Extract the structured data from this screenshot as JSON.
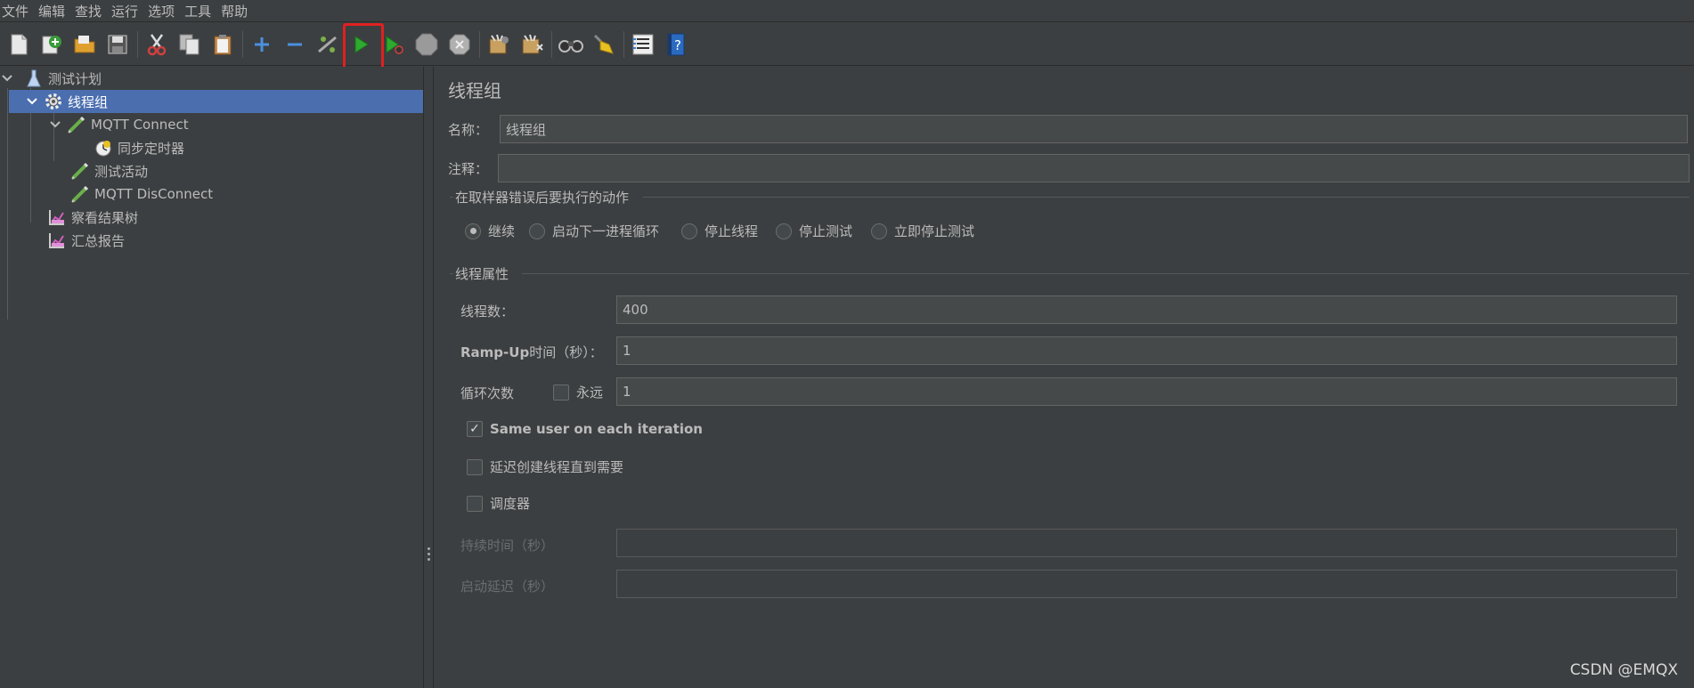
{
  "menu": [
    "文件",
    "编辑",
    "查找",
    "运行",
    "选项",
    "工具",
    "帮助"
  ],
  "toolbar": {
    "buttons": [
      {
        "name": "new-icon",
        "color": "#e8e8e8"
      },
      {
        "name": "templates-icon",
        "color": "#4caf50"
      },
      {
        "name": "open-icon",
        "color": "#e0a030"
      },
      {
        "name": "save-icon",
        "color": "#cccccc"
      },
      {
        "name": "cut-icon",
        "color": "#d04040"
      },
      {
        "name": "copy-icon",
        "color": "#cccccc"
      },
      {
        "name": "paste-icon",
        "color": "#d0a060"
      },
      {
        "name": "expand-icon",
        "color": "#4a90e0"
      },
      {
        "name": "collapse-icon",
        "color": "#4a90e0"
      },
      {
        "name": "toggle-icon",
        "color": "#aaaaaa"
      },
      {
        "name": "start-icon",
        "color": "#2eaa2e"
      },
      {
        "name": "start-no-pause-icon",
        "color": "#2eaa2e"
      },
      {
        "name": "stop-icon",
        "color": "#9a9a9a"
      },
      {
        "name": "shutdown-icon",
        "color": "#b0b0b0"
      },
      {
        "name": "remote-start-icon",
        "color": "#c8a060"
      },
      {
        "name": "remote-stop-icon",
        "color": "#c8a060"
      },
      {
        "name": "search-icon",
        "color": "#444444"
      },
      {
        "name": "clear-icon",
        "color": "#e8c020"
      },
      {
        "name": "function-helper-icon",
        "color": "#dddddd"
      },
      {
        "name": "help-icon",
        "color": "#3a80d0"
      }
    ],
    "highlight": "start-icon"
  },
  "tree": {
    "items": [
      {
        "label": "测试计划",
        "level": 0,
        "expanded": true,
        "icon": "test-plan-icon"
      },
      {
        "label": "线程组",
        "level": 1,
        "expanded": true,
        "icon": "gear-icon",
        "selected": true
      },
      {
        "label": "MQTT Connect",
        "level": 2,
        "expanded": true,
        "icon": "sampler-icon"
      },
      {
        "label": "同步定时器",
        "level": 3,
        "icon": "timer-icon"
      },
      {
        "label": "测试活动",
        "level": 2,
        "icon": "sampler-icon"
      },
      {
        "label": "MQTT DisConnect",
        "level": 2,
        "icon": "sampler-icon"
      },
      {
        "label": "察看结果树",
        "level": 1,
        "icon": "listener-icon"
      },
      {
        "label": "汇总报告",
        "level": 1,
        "icon": "listener-icon"
      }
    ]
  },
  "panel": {
    "title": "线程组",
    "name_label": "名称：",
    "name_value": "线程组",
    "comment_label": "注释：",
    "comment_value": "",
    "error_group_title": "在取样器错误后要执行的动作",
    "error_actions": [
      {
        "label": "继续",
        "checked": true
      },
      {
        "label": "启动下一进程循环",
        "checked": false
      },
      {
        "label": "停止线程",
        "checked": false
      },
      {
        "label": "停止测试",
        "checked": false
      },
      {
        "label": "立即停止测试",
        "checked": false
      }
    ],
    "thread_group_title": "线程属性",
    "threads_label": "线程数：",
    "threads_value": "400",
    "rampup_label_bold": "Ramp-Up",
    "rampup_label_rest": "时间（秒）：",
    "rampup_value": "1",
    "loop_label": "循环次数",
    "forever_label": "永远",
    "forever_checked": false,
    "loop_value": "1",
    "same_user_label": "Same user on each iteration",
    "same_user_checked": true,
    "delay_create_label": "延迟创建线程直到需要",
    "delay_create_checked": false,
    "scheduler_label": "调度器",
    "scheduler_checked": false,
    "duration_label": "持续时间（秒）",
    "duration_value": "",
    "startup_delay_label": "启动延迟（秒）",
    "startup_delay_value": ""
  },
  "watermark": "CSDN @EMQX"
}
